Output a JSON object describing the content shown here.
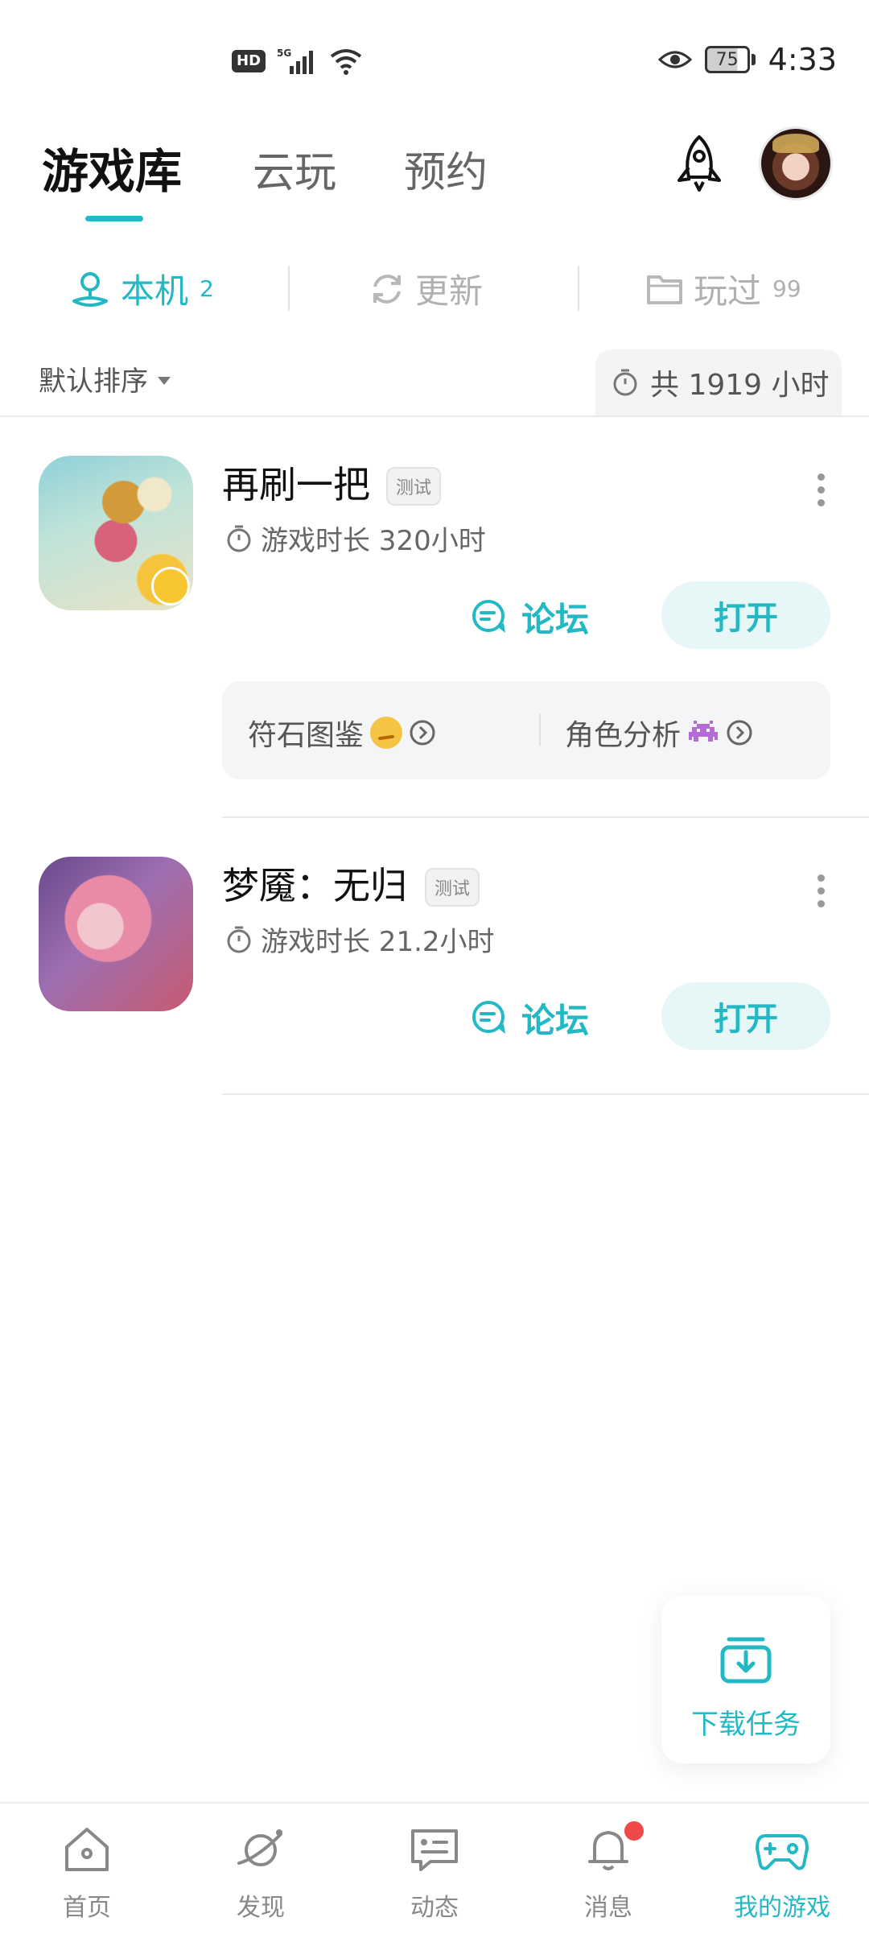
{
  "status_bar": {
    "hd": "HD",
    "network": "5G",
    "battery": "75",
    "time": "4:33"
  },
  "header": {
    "tabs": [
      {
        "label": "游戏库",
        "active": true
      },
      {
        "label": "云玩",
        "active": false
      },
      {
        "label": "预约",
        "active": false
      }
    ]
  },
  "sub_tabs": [
    {
      "label": "本机",
      "count": "2",
      "active": true,
      "icon": "location-pin-icon"
    },
    {
      "label": "更新",
      "count": "",
      "active": false,
      "icon": "refresh-icon"
    },
    {
      "label": "玩过",
      "count": "99",
      "active": false,
      "icon": "folder-icon"
    }
  ],
  "sort": {
    "label": "默认排序"
  },
  "total_time": {
    "label": "共 1919 小时"
  },
  "games": [
    {
      "title": "再刷一把",
      "badge": "测试",
      "play_time": "游戏时长 320小时",
      "forum_label": "论坛",
      "open_label": "打开",
      "quick_links": [
        "符石图鉴",
        "角色分析"
      ]
    },
    {
      "title": "梦魇：无归",
      "badge": "测试",
      "play_time": "游戏时长 21.2小时",
      "forum_label": "论坛",
      "open_label": "打开"
    }
  ],
  "download_task": {
    "label": "下载任务"
  },
  "bottom_nav": [
    {
      "label": "首页",
      "icon": "home-icon",
      "active": false
    },
    {
      "label": "发现",
      "icon": "planet-icon",
      "active": false
    },
    {
      "label": "动态",
      "icon": "chat-icon",
      "active": false
    },
    {
      "label": "消息",
      "icon": "bell-icon",
      "active": false,
      "badge_dot": true
    },
    {
      "label": "我的游戏",
      "icon": "gamepad-icon",
      "active": true
    }
  ],
  "colors": {
    "accent": "#22b8c4",
    "notification": "#f04848"
  }
}
